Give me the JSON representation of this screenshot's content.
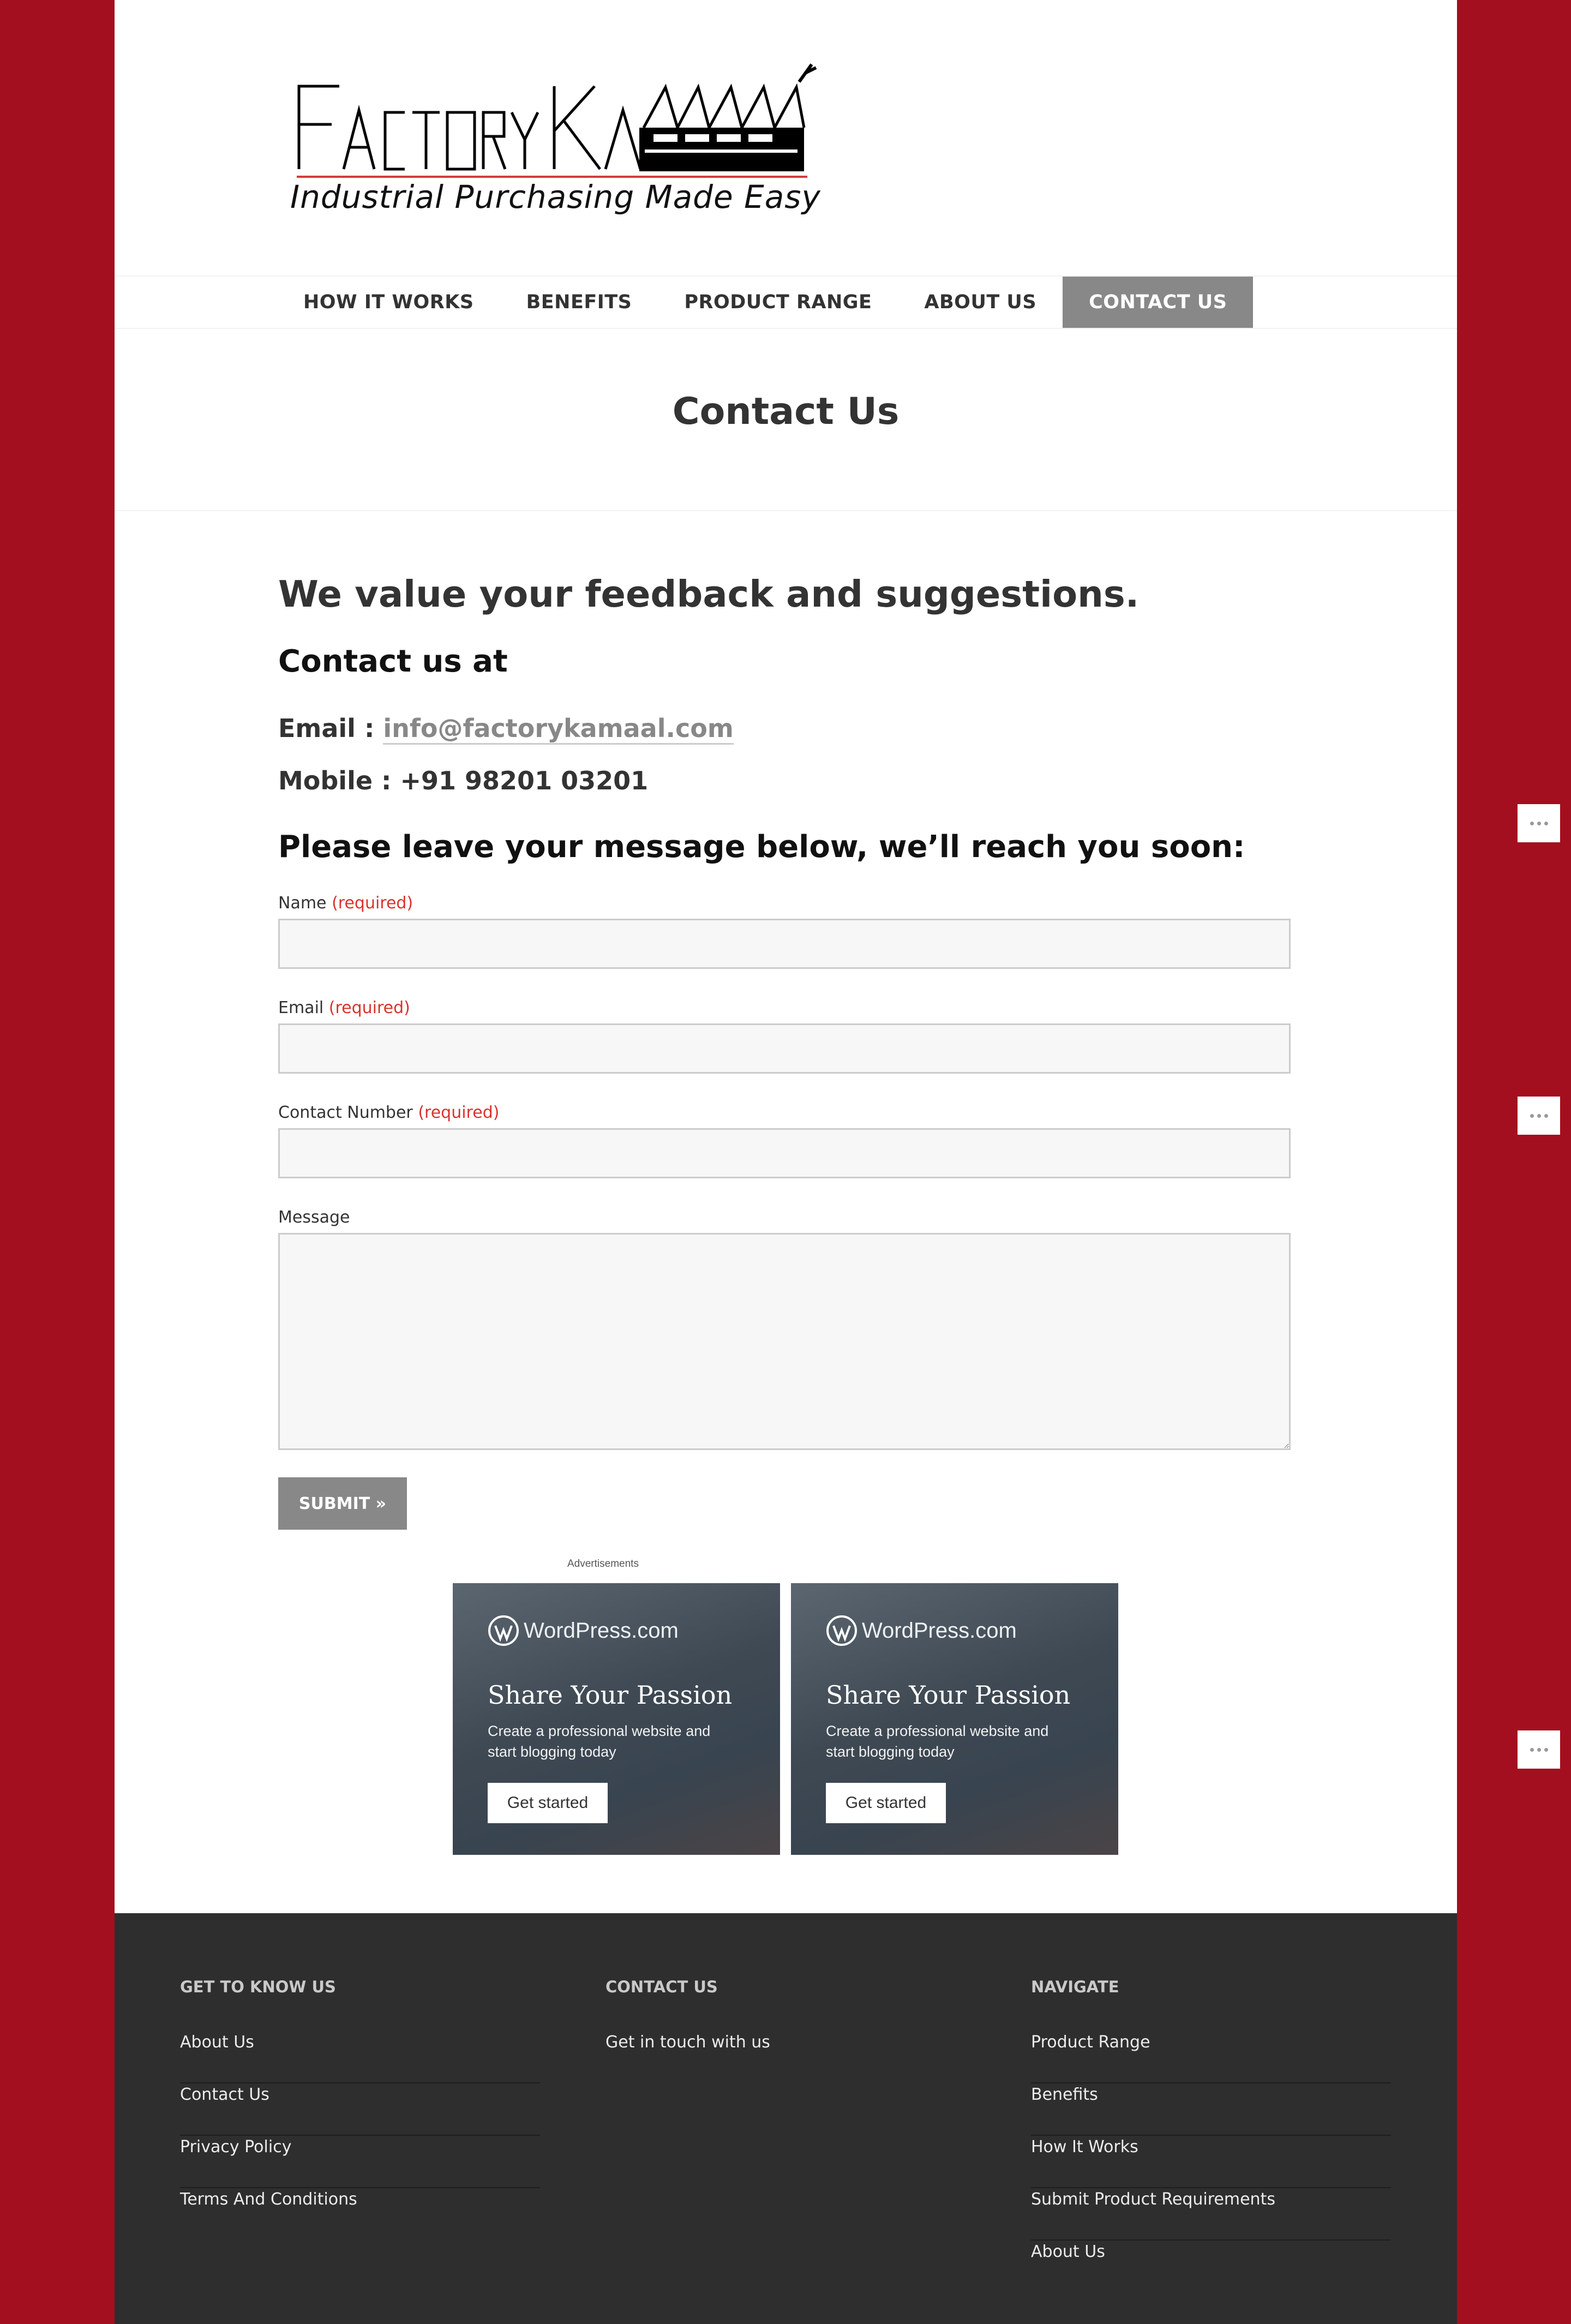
{
  "site": {
    "logo_text": "Factory Kamaal",
    "tagline": "Industrial Purchasing Made Easy"
  },
  "nav": {
    "items": [
      {
        "label": "HOW IT WORKS"
      },
      {
        "label": "BENEFITS"
      },
      {
        "label": "PRODUCT RANGE"
      },
      {
        "label": "ABOUT US"
      },
      {
        "label": "CONTACT US"
      }
    ],
    "active": "CONTACT US"
  },
  "page": {
    "title": "Contact Us"
  },
  "content": {
    "feedback_heading": "We value your feedback and suggestions.",
    "contact_at": "Contact us at",
    "email_label": "Email : ",
    "email_value": "info@factorykamaal.com",
    "mobile": "Mobile : +91 98201 03201",
    "leave_message": "Please leave your message below, we’ll reach you soon:"
  },
  "form": {
    "required_text": "(required)",
    "name_label": "Name",
    "email_label": "Email",
    "contact_label": "Contact Number",
    "message_label": "Message",
    "name_value": "",
    "email_value": "",
    "contact_value": "",
    "message_value": "",
    "submit_label": "SUBMIT »"
  },
  "ads": {
    "label": "Advertisements",
    "items": [
      {
        "brand": "WordPress.com",
        "headline": "Share Your Passion",
        "sub": "Create a professional website and start blogging today",
        "cta": "Get started"
      },
      {
        "brand": "WordPress.com",
        "headline": "Share Your Passion",
        "sub": "Create a professional website and start blogging today",
        "cta": "Get started"
      }
    ]
  },
  "footer": {
    "col1": {
      "title": "GET TO KNOW US",
      "links": [
        "About Us",
        "Contact Us",
        "Privacy Policy",
        "Terms And Conditions"
      ]
    },
    "col2": {
      "title": "CONTACT US",
      "links": [
        "Get in touch with us"
      ]
    },
    "col3": {
      "title": "NAVIGATE",
      "links": [
        "Product Range",
        "Benefits",
        "How It Works",
        "Submit Product Requirements",
        "About Us"
      ]
    }
  },
  "colors": {
    "background": "#a30f1e",
    "nav_active": "#888888",
    "required": "#d9322c",
    "footer": "#2e2e2e"
  }
}
